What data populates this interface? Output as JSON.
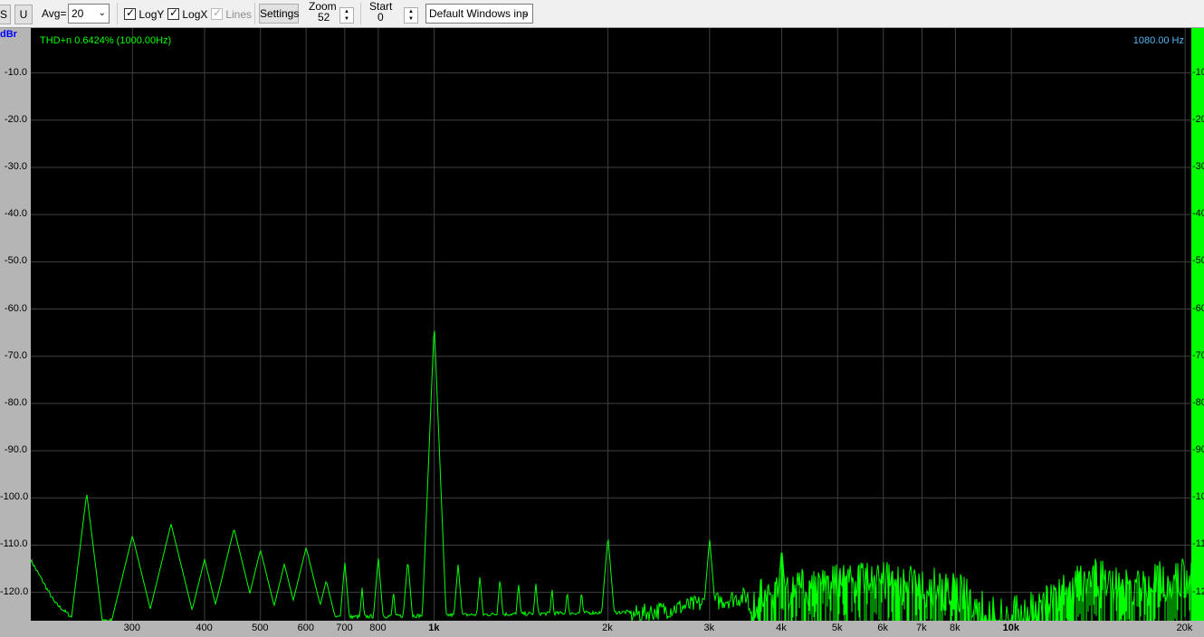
{
  "toolbar": {
    "btn_s": "S",
    "btn_u": "U",
    "avg_label": "Avg=",
    "avg_value": "20",
    "logy": {
      "label": "LogY",
      "checked": true
    },
    "logx": {
      "label": "LogX",
      "checked": true
    },
    "lines": {
      "label": "Lines",
      "checked": true,
      "disabled": true
    },
    "settings_label": "Settings",
    "zoom_label": "Zoom",
    "zoom_value": "52",
    "start_label": "Start",
    "start_value": "0",
    "input_device": "Default Windows inp"
  },
  "plot": {
    "corner_label": "dBr",
    "thd_readout": "THD+n 0.6424% (1000.00Hz)",
    "cursor_readout": "1080.00 Hz",
    "trace_color": "#00ff00",
    "thd_color": "#00ff00",
    "cursor_color": "#5ab4f0",
    "grid_color": "#404040"
  },
  "chart_data": {
    "type": "line",
    "title": "",
    "xlabel": "",
    "ylabel": "dBr",
    "x_scale": "log",
    "y_scale": "linear",
    "xlim": [
      200,
      20500
    ],
    "ylim": [
      -126,
      -0.5
    ],
    "grid": true,
    "yticks": [
      -10,
      -20,
      -30,
      -40,
      -50,
      -60,
      -70,
      -80,
      -90,
      -100,
      -110,
      -120
    ],
    "ytick_labels": [
      "-10.0",
      "-20.0",
      "-30.0",
      "-40.0",
      "-50.0",
      "-60.0",
      "-70.0",
      "-80.0",
      "-90.0",
      "-100.0",
      "-110.0",
      "-120.0"
    ],
    "xticks": [
      300,
      400,
      500,
      600,
      700,
      800,
      1000,
      2000,
      3000,
      4000,
      5000,
      6000,
      7000,
      8000,
      10000,
      20000
    ],
    "xtick_labels": [
      "300",
      "400",
      "500",
      "600",
      "700",
      "800",
      "1k",
      "2k",
      "3k",
      "4k",
      "5k",
      "6k",
      "7k",
      "8k",
      "10k",
      "20k"
    ],
    "bold_xticks": [
      "1k",
      "10k"
    ],
    "peaks": [
      {
        "x": 250,
        "y": -99
      },
      {
        "x": 300,
        "y": -108
      },
      {
        "x": 350,
        "y": -105.5
      },
      {
        "x": 400,
        "y": -113
      },
      {
        "x": 450,
        "y": -106.5
      },
      {
        "x": 500,
        "y": -111
      },
      {
        "x": 550,
        "y": -114
      },
      {
        "x": 600,
        "y": -110.5
      },
      {
        "x": 650,
        "y": -117.5
      },
      {
        "x": 700,
        "y": -113.5
      },
      {
        "x": 750,
        "y": -119
      },
      {
        "x": 800,
        "y": -112.5
      },
      {
        "x": 850,
        "y": -119.5
      },
      {
        "x": 900,
        "y": -113
      },
      {
        "x": 1000,
        "y": -63
      },
      {
        "x": 1100,
        "y": -114
      },
      {
        "x": 1200,
        "y": -116.5
      },
      {
        "x": 1300,
        "y": -117
      },
      {
        "x": 1400,
        "y": -118
      },
      {
        "x": 1500,
        "y": -118
      },
      {
        "x": 1600,
        "y": -119
      },
      {
        "x": 1700,
        "y": -119.5
      },
      {
        "x": 1800,
        "y": -119.5
      },
      {
        "x": 2000,
        "y": -108
      },
      {
        "x": 3000,
        "y": -108.5
      },
      {
        "x": 4000,
        "y": -110.5
      }
    ],
    "noise_floor": [
      {
        "x": 200,
        "y": -113
      },
      {
        "x": 220,
        "y": -122
      },
      {
        "x": 240,
        "y": -126
      },
      {
        "x": 2200,
        "y": -124
      },
      {
        "x": 3500,
        "y": -120
      },
      {
        "x": 4500,
        "y": -117
      },
      {
        "x": 6000,
        "y": -116
      },
      {
        "x": 8000,
        "y": -118
      },
      {
        "x": 9500,
        "y": -124
      },
      {
        "x": 11000,
        "y": -122
      },
      {
        "x": 12000,
        "y": -119
      },
      {
        "x": 14000,
        "y": -115
      },
      {
        "x": 16000,
        "y": -118
      },
      {
        "x": 18000,
        "y": -116
      },
      {
        "x": 20500,
        "y": -115
      }
    ]
  }
}
